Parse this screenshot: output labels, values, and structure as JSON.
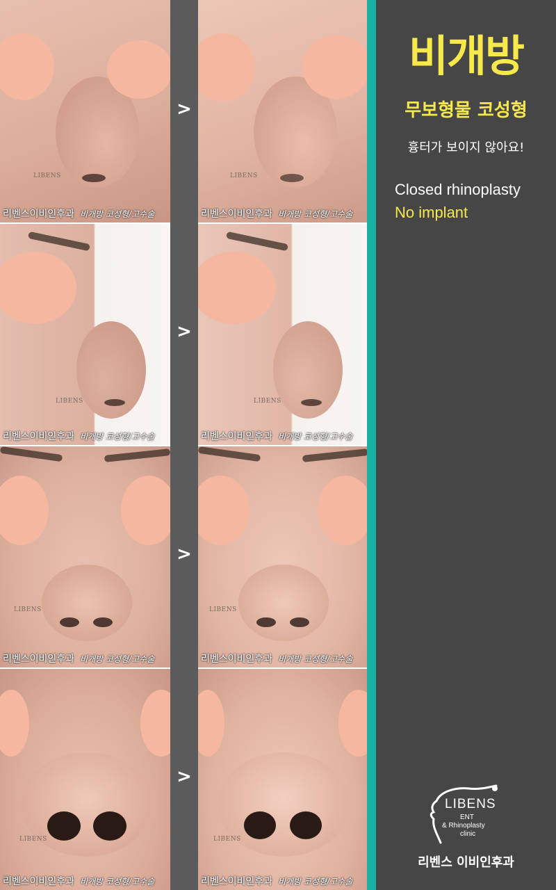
{
  "panel": {
    "title": "비개방",
    "subtitle": "무보형물 코성형",
    "tagline": "흉터가 보이지 않아요!",
    "english_line1": "Closed rhinoplasty",
    "english_line2": "No implant",
    "logo_name": "LIBENS",
    "logo_ent": "ENT",
    "logo_rhino": "& Rhinoplasty",
    "logo_clinic": "clinic",
    "clinic_name": "리벤스 이비인후과"
  },
  "photo": {
    "watermark": "LIBENS",
    "caption_clinic": "리벤스이비인후과",
    "caption_procedure": "비개방 코성형/고수술"
  },
  "arrow_symbol": ">",
  "rows": [
    {
      "view": "oblique",
      "arrow": ">"
    },
    {
      "view": "profile",
      "arrow": ">"
    },
    {
      "view": "front",
      "arrow": ">"
    },
    {
      "view": "base",
      "arrow": ">"
    }
  ],
  "colors": {
    "accent_yellow": "#f7e94c",
    "teal_bar": "#18b0a0",
    "panel_bg": "#464646",
    "divider": "#5b5b5b",
    "face_mask": "#f5b7a0"
  }
}
